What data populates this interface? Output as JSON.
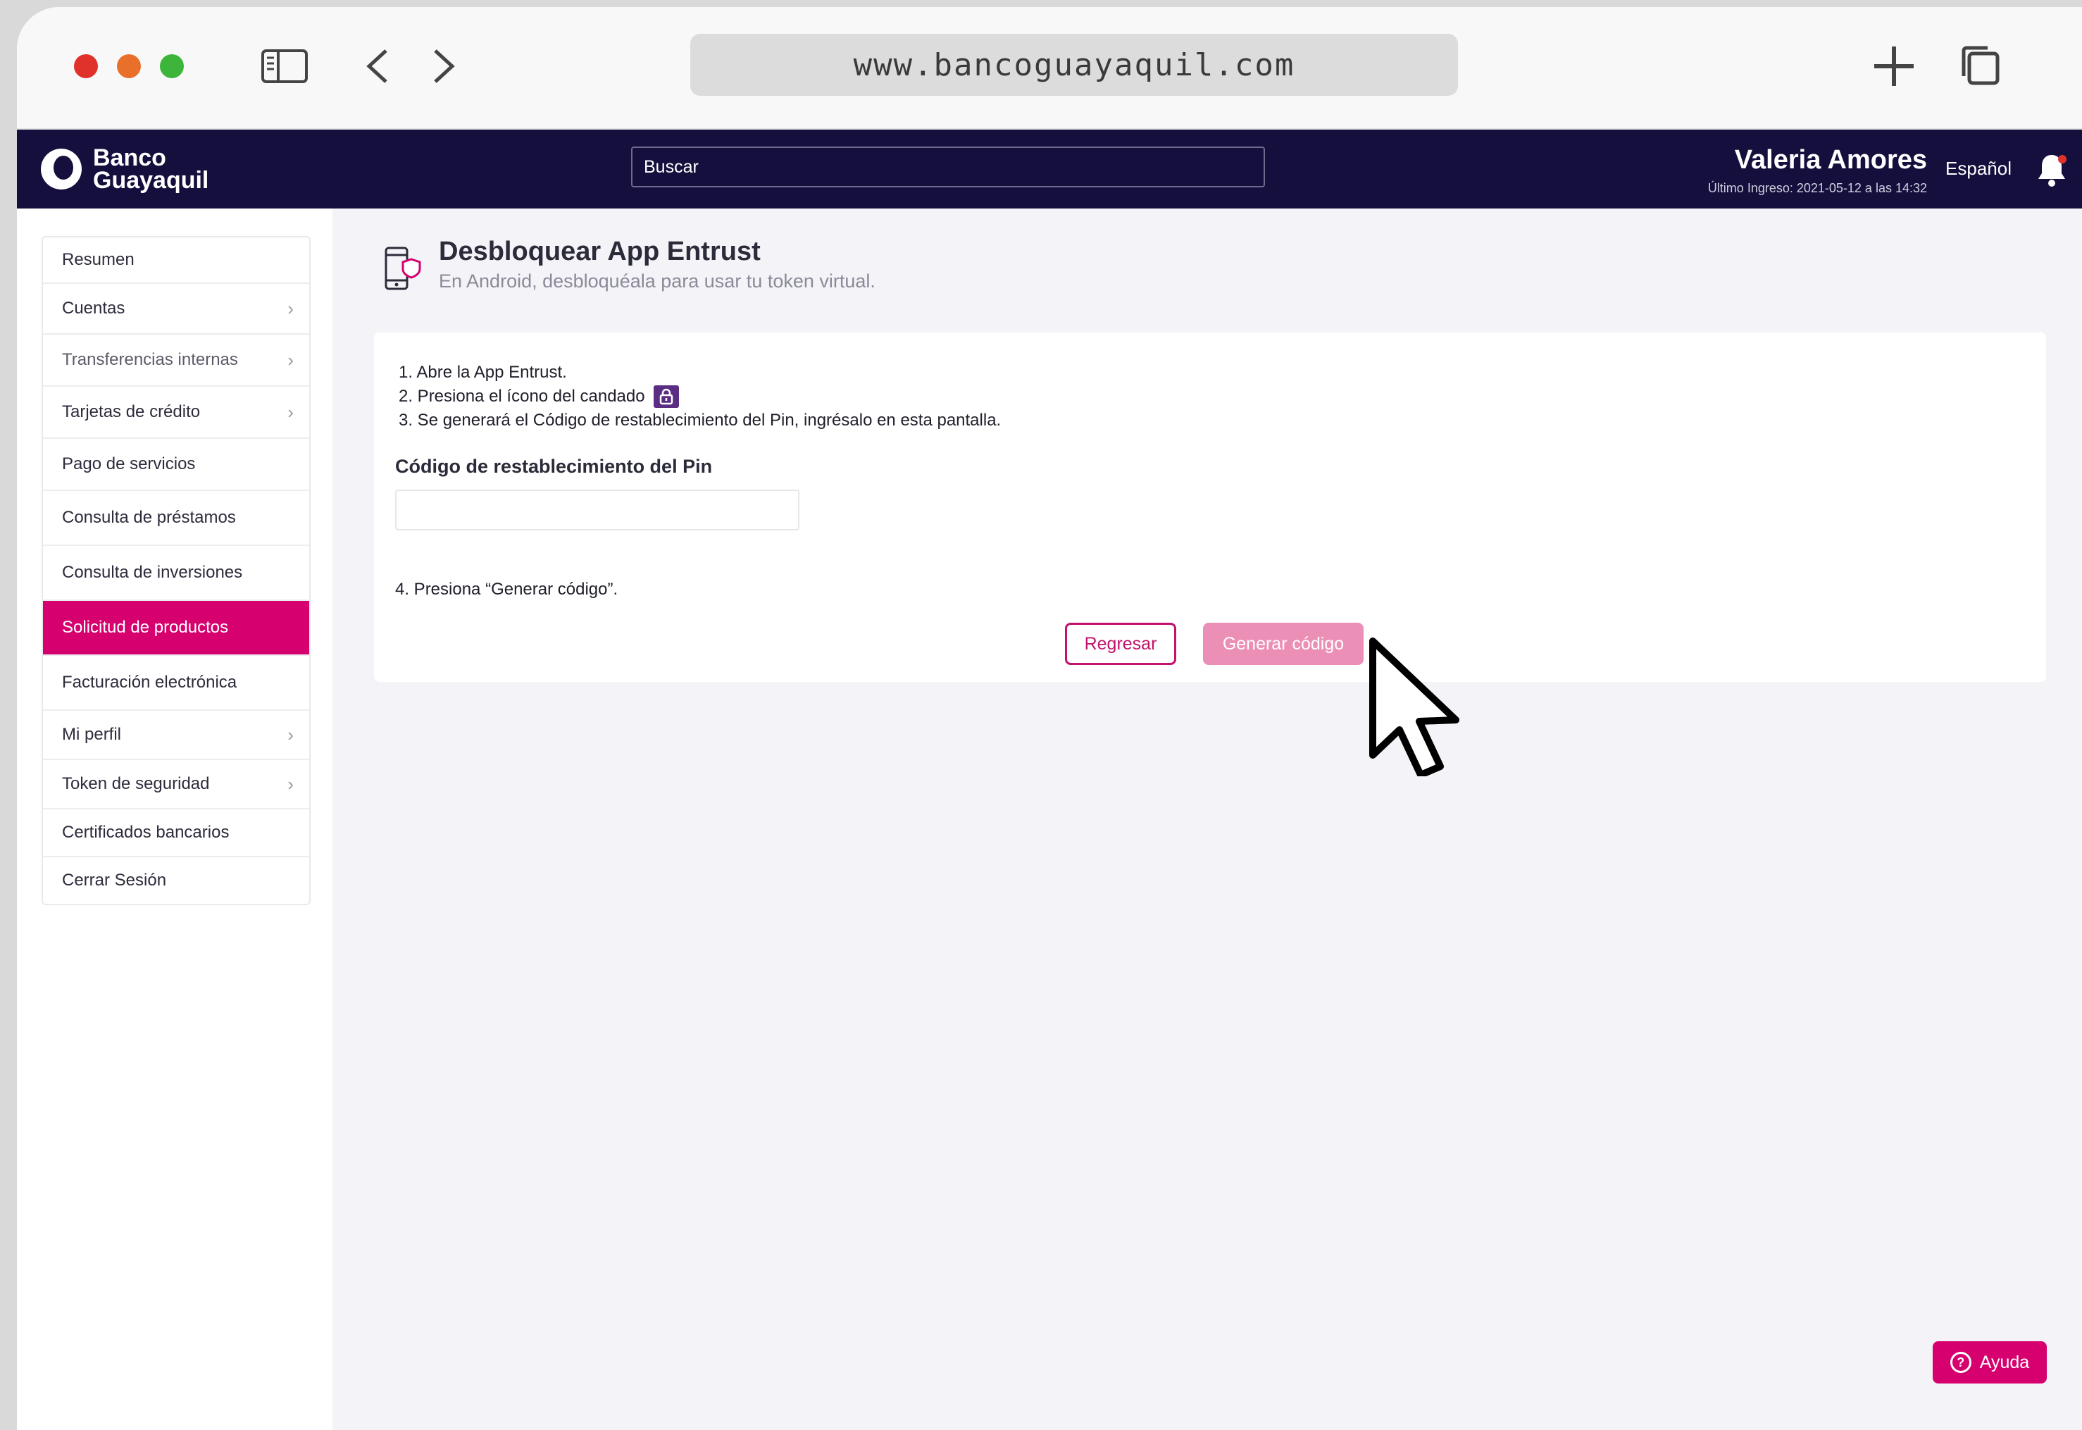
{
  "browser": {
    "url": "www.bancoguayaquil.com"
  },
  "header": {
    "logo_line1": "Banco",
    "logo_line2": "Guayaquil",
    "search_placeholder": "Buscar",
    "user_name": "Valeria Amores",
    "last_login": "Último Ingreso: 2021-05-12 a las 14:32",
    "language": "Español"
  },
  "sidebar": {
    "items": [
      {
        "label": "Resumen"
      },
      {
        "label": "Cuentas"
      },
      {
        "label": "Transferencias internas"
      },
      {
        "label": "Tarjetas de crédito"
      },
      {
        "label": "Pago de servicios"
      },
      {
        "label": "Consulta de préstamos"
      },
      {
        "label": "Consulta de inversiones"
      },
      {
        "label": "Solicitud de productos"
      },
      {
        "label": "Facturación electrónica"
      },
      {
        "label": "Mi perfil"
      },
      {
        "label": "Token de seguridad"
      },
      {
        "label": "Certificados bancarios"
      },
      {
        "label": "Cerrar Sesión"
      }
    ],
    "active_item": "Solicitud de productos"
  },
  "main": {
    "title": "Desbloquear App Entrust",
    "subtitle": "En Android, desbloquéala para usar tu token virtual.",
    "steps": [
      "1. Abre la App Entrust.",
      "2. Presiona el ícono del candado",
      "3.  Se generará el Código de restablecimiento del Pin, ingrésalo en esta pantalla."
    ],
    "field_label": "Código de restablecimiento del Pin",
    "field_value": "",
    "step4": "4. Presiona “Generar código”.",
    "back_button": "Regresar",
    "generate_button": "Generar código"
  },
  "help_button": "Ayuda",
  "colors": {
    "navbar": "#150f3d",
    "accent": "#d6006f",
    "button_disabled": "#ec8fb6",
    "lock_badge": "#5b2c83"
  },
  "icons": [
    "sidebar-toggle-icon",
    "back-arrow-icon",
    "forward-arrow-icon",
    "new-tab-icon",
    "tabs-icon",
    "bell-icon",
    "phone-shield-icon",
    "lock-icon",
    "help-icon",
    "mouse-cursor-icon"
  ]
}
